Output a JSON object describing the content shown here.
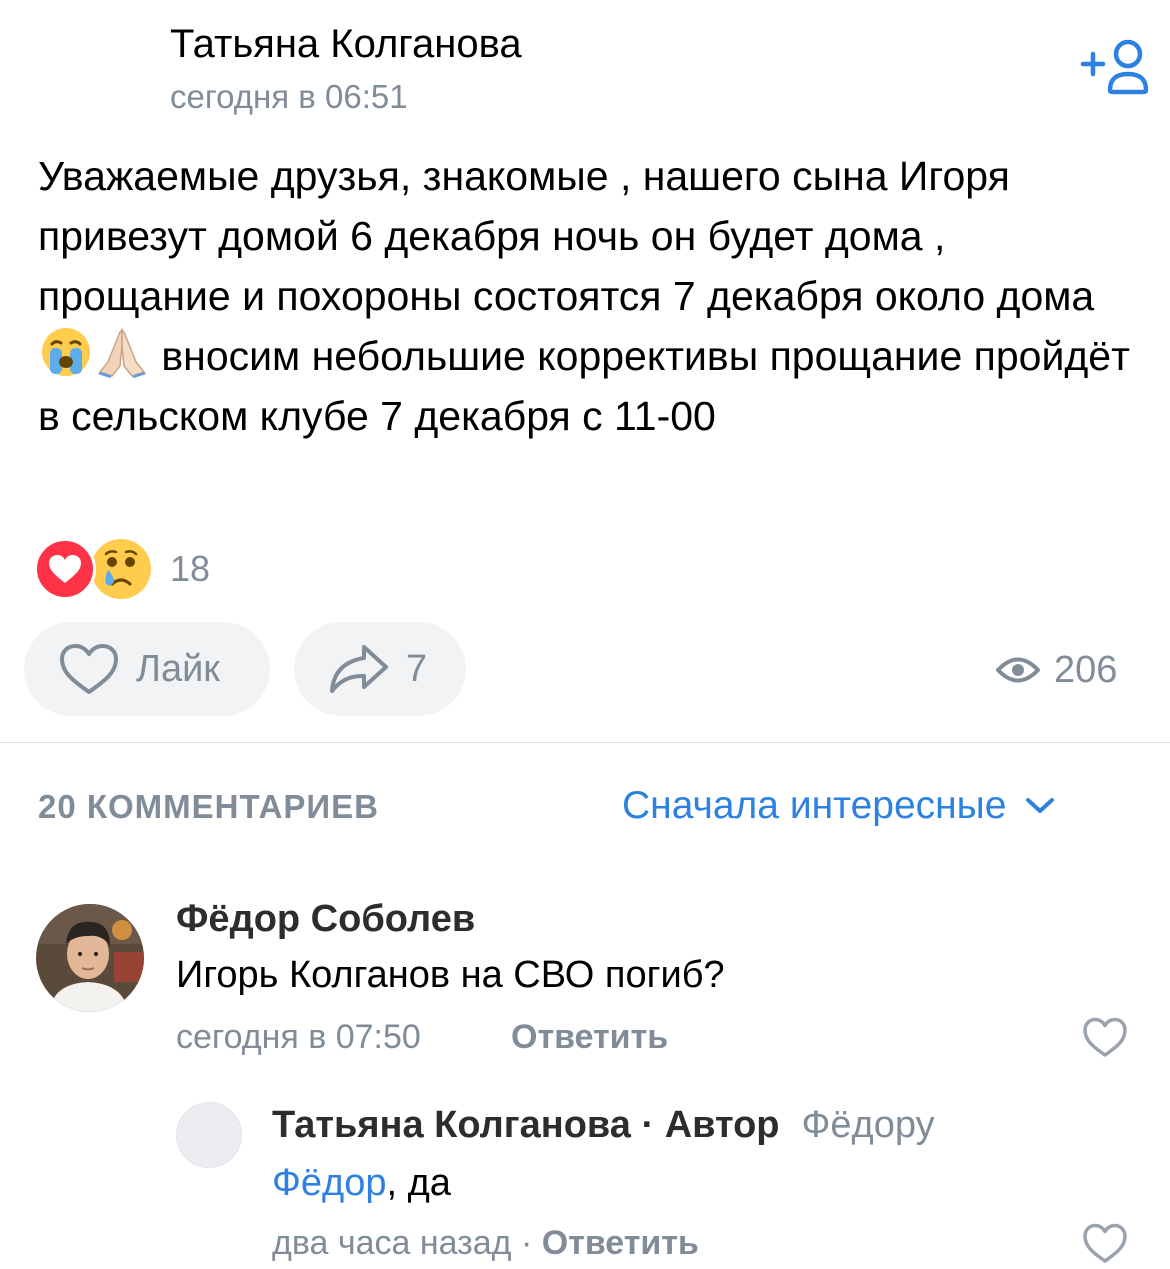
{
  "post": {
    "author": "Татьяна Колганова",
    "time": "сегодня в 06:51",
    "text_part1": "Уважаемые друзья,  знакомые ,  нашего сына Игоря привезут домой 6 декабря ночь он будет дома ,  прощание и похороны состоятся 7 декабря около дома",
    "text_part2": " вносим небольшие коррективы прощание пройдёт в сельском клубе 7 декабря с 11-00",
    "emojis": [
      "crying-face-emoji",
      "folded-hands-emoji"
    ],
    "reactions_count": "18",
    "reaction_icons": [
      "heart-reaction-icon",
      "crying-reaction-icon"
    ],
    "like_label": "Лайк",
    "share_count": "7",
    "views": "206"
  },
  "comments": {
    "count_label": "20 КОММЕНТАРИЕВ",
    "sort_label": "Сначала интересные",
    "items": [
      {
        "author": "Фёдор Соболев",
        "text": "Игорь Колганов на СВО погиб?",
        "time": "сегодня в 07:50",
        "reply_label": "Ответить"
      },
      {
        "author": "Татьяна Колганова",
        "separator": " · ",
        "role": "Автор",
        "reply_to": "Фёдору",
        "mention": "Фёдор",
        "text": ", да",
        "time": "два часа назад",
        "dot": " · ",
        "reply_label": "Ответить"
      }
    ]
  },
  "colors": {
    "accent": "#2d81e0",
    "secondary_text": "#818c99",
    "button_bg": "#f2f3f5",
    "heart_red": "#ff3347"
  }
}
